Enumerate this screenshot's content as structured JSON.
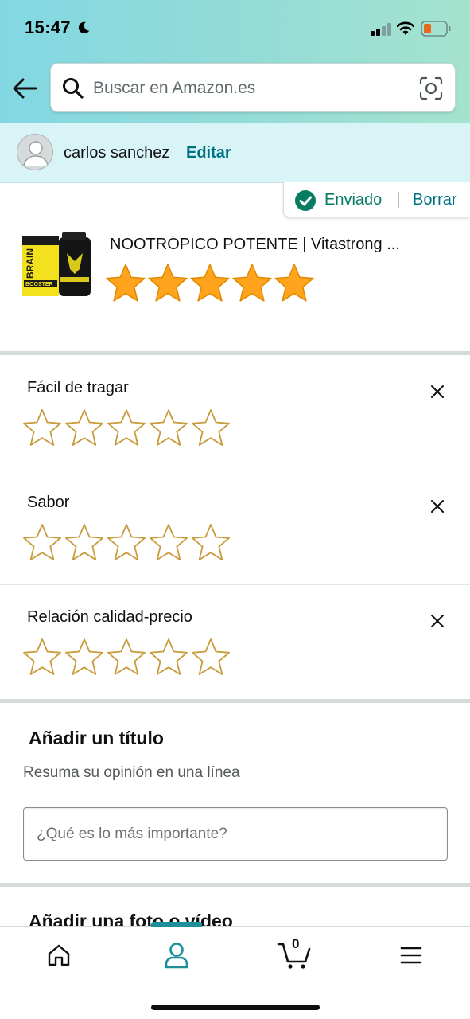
{
  "status_bar": {
    "time": "15:47"
  },
  "search": {
    "placeholder": "Buscar en Amazon.es"
  },
  "user": {
    "name": "carlos sanchez",
    "edit_label": "Editar"
  },
  "review_status": {
    "status_label": "Enviado",
    "delete_label": "Borrar"
  },
  "product": {
    "title": "NOOTRÓPICO POTENTE | Vitastrong ...",
    "image_text": "BRAIN BOOSTER",
    "overall_rating": 5,
    "rating_max": 5
  },
  "attributes": [
    {
      "label": "Fácil de tragar",
      "rating": 0
    },
    {
      "label": "Sabor",
      "rating": 0
    },
    {
      "label": "Relación calidad-precio",
      "rating": 0
    }
  ],
  "title_section": {
    "heading": "Añadir un título",
    "subheading": "Resuma su opinión en una línea",
    "input_value": "",
    "input_placeholder": "¿Qué es lo más importante?"
  },
  "photo_section": {
    "heading": "Añadir una foto o vídeo"
  },
  "bottom_nav": {
    "items": [
      "home-icon",
      "account-icon",
      "cart-icon",
      "menu-icon"
    ],
    "active": "account",
    "cart_count": "0"
  },
  "colors": {
    "accent": "#007185",
    "success": "#067d62",
    "star_fill": "#ffa41c",
    "star_outline": "#c89b3c",
    "nav_active": "#1c8f9a"
  }
}
